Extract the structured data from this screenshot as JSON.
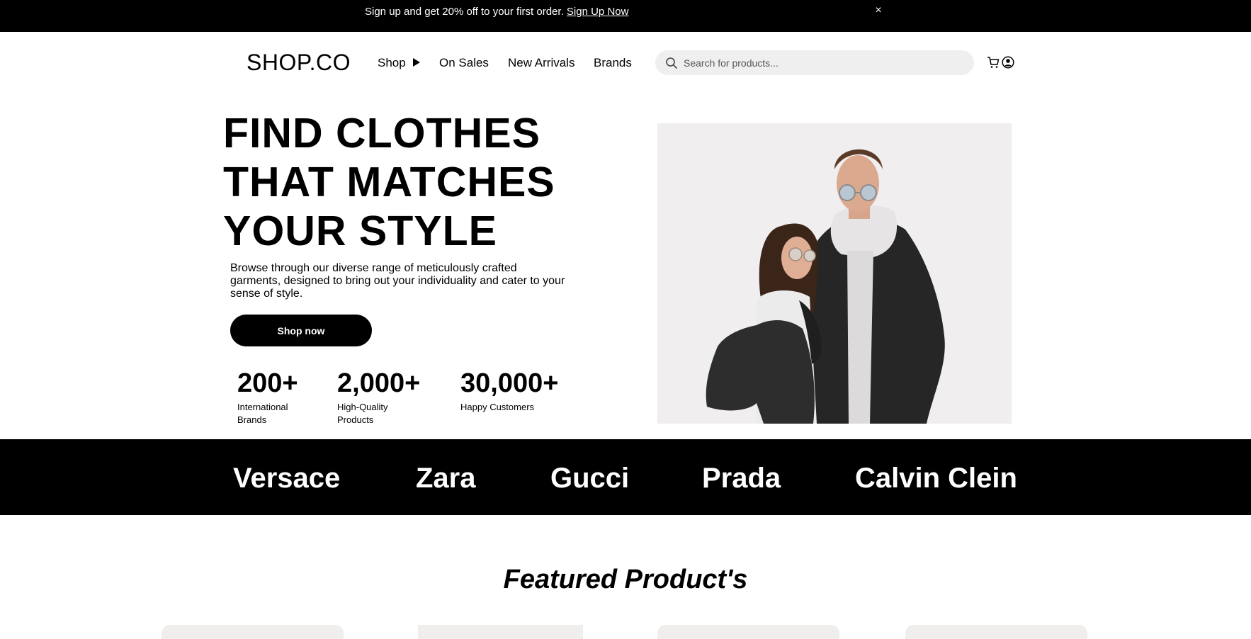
{
  "announcement": {
    "text": "Sign up and get 20% off to your first order. ",
    "link": "Sign Up Now",
    "close": "×"
  },
  "header": {
    "logo": "SHOP.CO",
    "nav": [
      {
        "label": "Shop"
      },
      {
        "label": "On Sales"
      },
      {
        "label": "New Arrivals"
      },
      {
        "label": "Brands"
      }
    ],
    "search_placeholder": "Search for products..."
  },
  "hero": {
    "title_lines": [
      "FIND CLOTHES",
      "THAT MATCHES",
      "YOUR STYLE"
    ],
    "description": "Browse through our diverse range of meticulously crafted garments, designed to bring out your individuality and cater to your sense of style.",
    "cta": "Shop now",
    "stats": [
      {
        "value": "200+",
        "label": "International Brands"
      },
      {
        "value": "2,000+",
        "label": "High-Quality Products"
      },
      {
        "value": "30,000+",
        "label": "Happy Customers"
      }
    ]
  },
  "brands": [
    "Versace",
    "Zara",
    "Gucci",
    "Prada",
    "Calvin Clein"
  ],
  "featured": {
    "title": "Featured Product's"
  },
  "colors": {
    "primary": "#000000",
    "background": "#ffffff",
    "search_bg": "#efefef",
    "hero_image_bg": "#f0eeef"
  }
}
